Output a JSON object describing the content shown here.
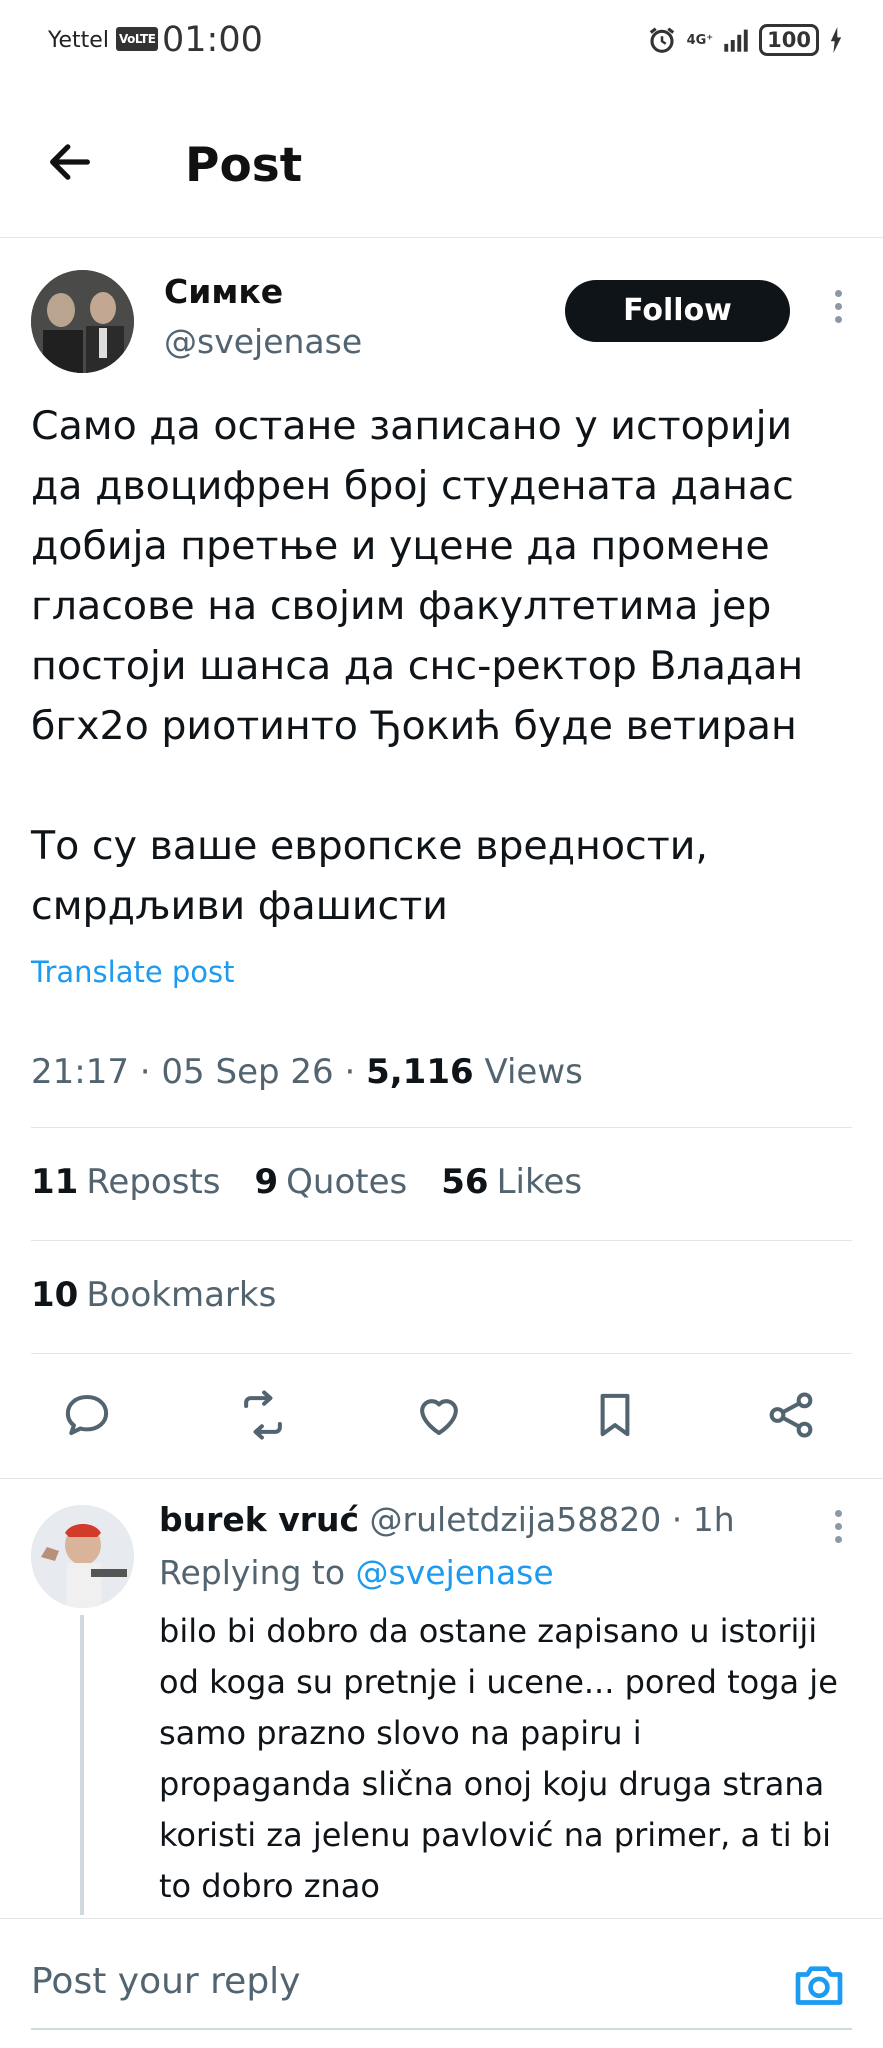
{
  "status_bar": {
    "carrier": "Yettel",
    "volte": "VoLTE",
    "time": "01:00",
    "network": "4G⁺",
    "battery": "100"
  },
  "header": {
    "title": "Post"
  },
  "post": {
    "author_name": "Симке",
    "author_handle": "@svejenase",
    "follow_label": "Follow",
    "body": "Само да остане записано у историји да двоцифрен број студената данас добија претње и уцене да промене гласове на својим факултетима јер постоји шанса да снс-ректор Владан бгх2о риотинто Ђокић буде ветиран\n\nТо су ваше европске вредности, смрдљиви фашисти",
    "translate_label": "Translate post",
    "time": "21:17",
    "date": "05 Sep 26",
    "views_count": "5,116",
    "views_label": "Views",
    "reposts_count": "11",
    "reposts_label": "Reposts",
    "quotes_count": "9",
    "quotes_label": "Quotes",
    "likes_count": "56",
    "likes_label": "Likes",
    "bookmarks_count": "10",
    "bookmarks_label": "Bookmarks"
  },
  "actions": [
    "reply-icon",
    "repost-icon",
    "like-icon",
    "bookmark-icon",
    "share-icon"
  ],
  "reply": {
    "name": "burek vruć",
    "handle": "@ruletdzija58820",
    "time": "1h",
    "replying_prefix": "Replying to",
    "replying_to": "@svejenase",
    "body": "bilo bi dobro da ostane zapisano u istoriji od koga su pretnje i ucene... pored toga je samo prazno slovo na papiru i propaganda slična onoj koju druga strana koristi za jelenu pavlović na primer, a ti bi to dobro znao"
  },
  "composer": {
    "placeholder": "Post your reply"
  },
  "colors": {
    "accent": "#1d9bf0",
    "text": "#0f1419",
    "secondary": "#536471"
  }
}
